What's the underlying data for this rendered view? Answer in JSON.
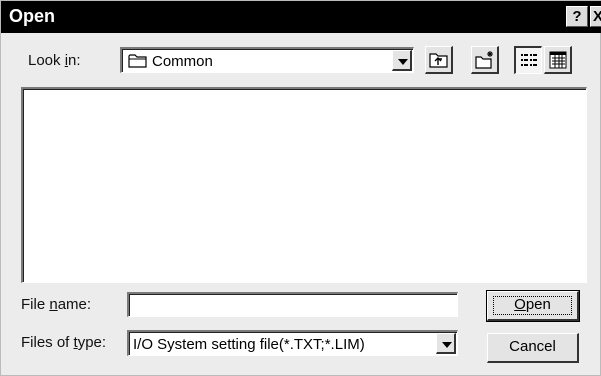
{
  "window": {
    "title": "Open",
    "help_label": "?",
    "close_label": "X"
  },
  "look_in": {
    "label_pre": "Look ",
    "label_accel": "i",
    "label_post": "n:",
    "value": "Common"
  },
  "file_name": {
    "label_pre": "File ",
    "label_accel": "n",
    "label_post": "ame:",
    "value": ""
  },
  "files_of_type": {
    "label_pre": "Files of ",
    "label_accel": "t",
    "label_post": "ype:",
    "value": "I/O System setting file(*.TXT;*.LIM)"
  },
  "buttons": {
    "open": {
      "accel": "O",
      "rest": "pen"
    },
    "cancel": "Cancel"
  },
  "file_list": {
    "items": []
  },
  "icons": [
    "folder-icon",
    "up-one-level-icon",
    "new-folder-icon",
    "list-view-icon",
    "details-view-icon",
    "dropdown-arrow-icon",
    "help-icon",
    "close-icon"
  ]
}
